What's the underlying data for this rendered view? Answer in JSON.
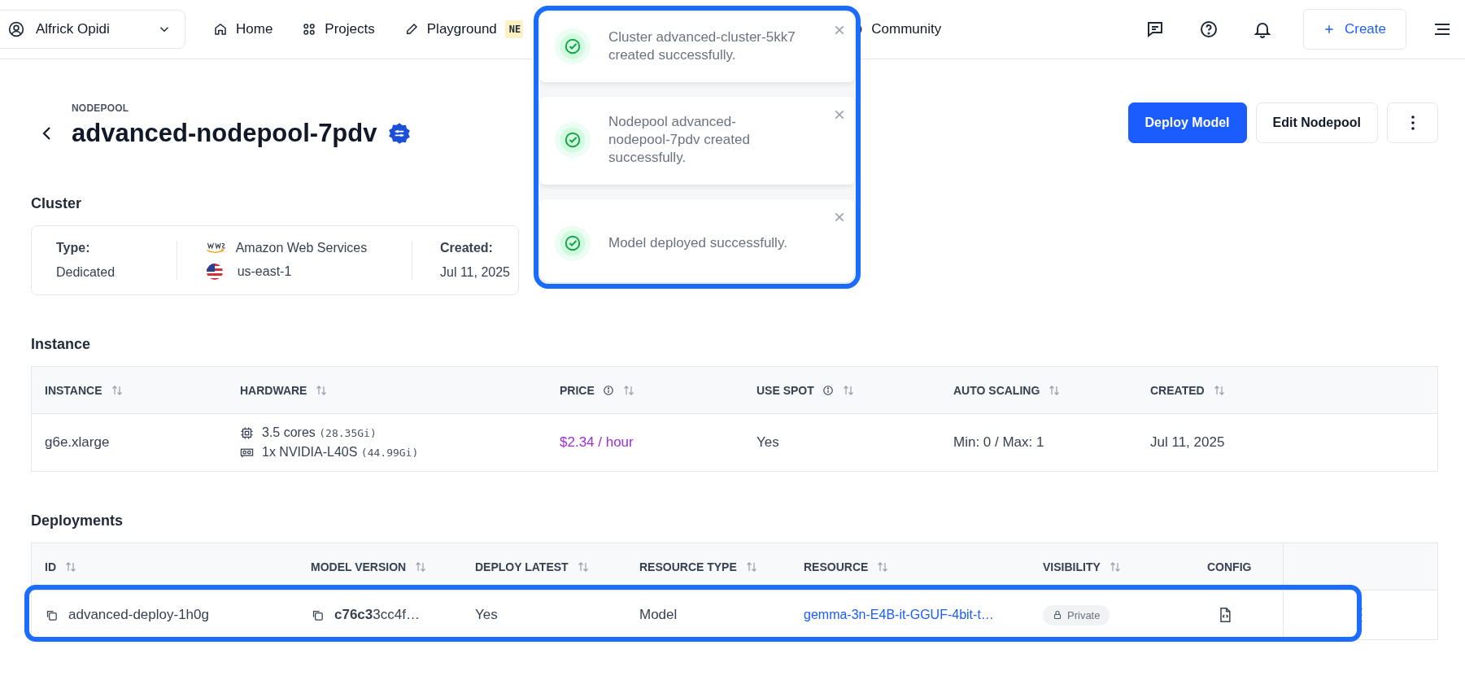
{
  "nav": {
    "user": "Alfrick Opidi",
    "items": [
      {
        "kind": "home",
        "label": "Home"
      },
      {
        "kind": "projects",
        "label": "Projects"
      },
      {
        "kind": "playground",
        "label": "Playground",
        "badge": "NE"
      },
      {
        "kind": "community",
        "label": "Community"
      }
    ],
    "create": "Create"
  },
  "toasts": [
    {
      "message": "Cluster advanced-cluster-5kk7 created successfully."
    },
    {
      "message": "Nodepool advanced-nodepool-7pdv created successfully."
    },
    {
      "message": "Model deployed successfully."
    }
  ],
  "header": {
    "overline": "NODEPOOL",
    "title": "advanced-nodepool-7pdv",
    "primary_action": "Deploy Model",
    "secondary_action": "Edit Nodepool"
  },
  "cluster": {
    "heading": "Cluster",
    "type_label": "Type:",
    "type": "Dedicated",
    "provider": "Amazon Web Services",
    "region": "us-east-1",
    "created_label": "Created:",
    "created": "Jul 11, 2025"
  },
  "instance": {
    "heading": "Instance",
    "columns": [
      {
        "label": "INSTANCE",
        "info": false
      },
      {
        "label": "HARDWARE",
        "info": false
      },
      {
        "label": "PRICE",
        "info": true
      },
      {
        "label": "USE SPOT",
        "info": true
      },
      {
        "label": "AUTO SCALING",
        "info": false
      },
      {
        "label": "CREATED",
        "info": false
      }
    ],
    "rows": [
      {
        "instance": "g6e.xlarge",
        "hardware": [
          {
            "kind": "cpu",
            "text": "3.5 cores",
            "detail": "(28.35Gi)"
          },
          {
            "kind": "gpu",
            "text": "1x NVIDIA-L40S",
            "detail": "(44.99Gi)"
          }
        ],
        "price": "$2.34 / hour",
        "use_spot": "Yes",
        "auto_scaling": "Min: 0 / Max: 1",
        "created": "Jul 11, 2025"
      }
    ]
  },
  "deployments": {
    "heading": "Deployments",
    "columns": [
      {
        "label": "ID",
        "sortable": true
      },
      {
        "label": "MODEL VERSION",
        "sortable": true
      },
      {
        "label": "DEPLOY LATEST",
        "sortable": true
      },
      {
        "label": "RESOURCE TYPE",
        "sortable": true
      },
      {
        "label": "RESOURCE",
        "sortable": true
      },
      {
        "label": "VISIBILITY",
        "sortable": true
      },
      {
        "label": "CONFIG",
        "sortable": false
      }
    ],
    "rows": [
      {
        "id": "advanced-deploy-1h0g",
        "model_version": "**c76c3**3cc4f…",
        "deploy_latest": "Yes",
        "resource_type": "Model",
        "resource": "gemma-3n-E4B-it-GGUF-4bit-t…",
        "visibility": "Private"
      }
    ]
  }
}
